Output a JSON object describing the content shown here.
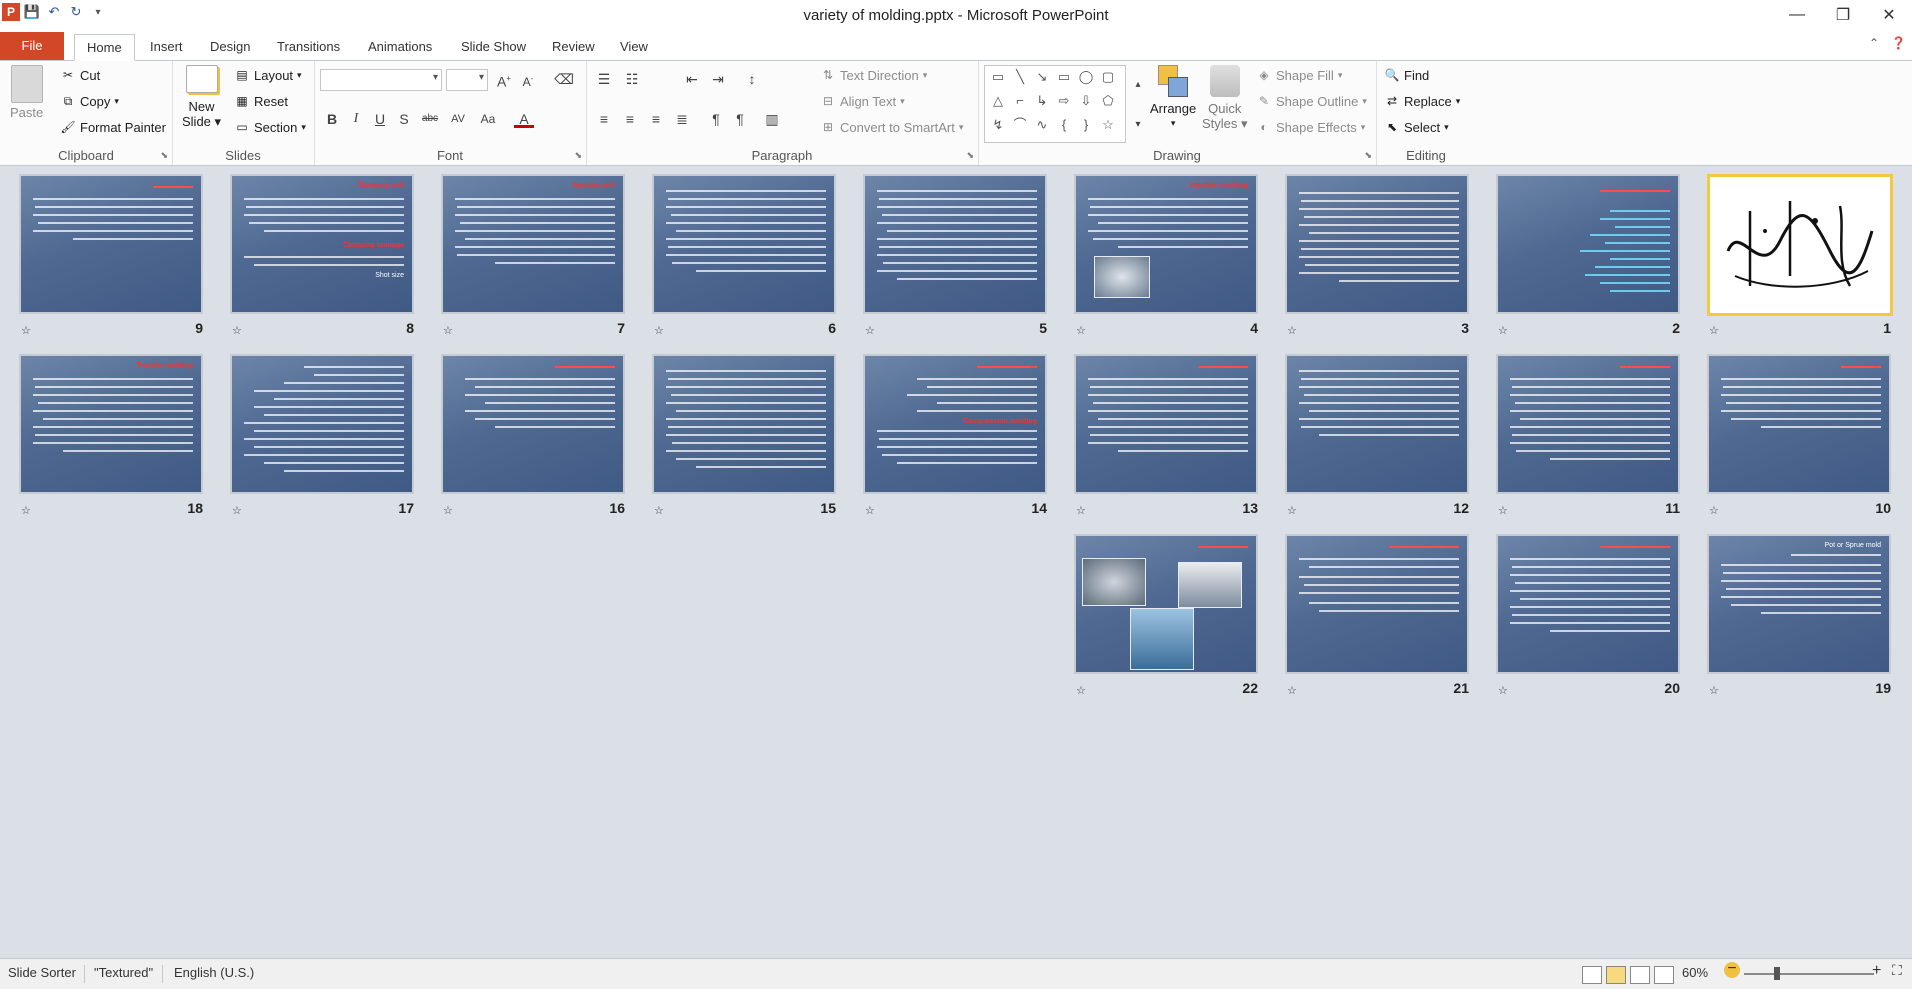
{
  "window": {
    "title": "variety of molding.pptx  -  Microsoft PowerPoint",
    "minimize": "—",
    "restore": "❐",
    "close": "✕"
  },
  "qat": {
    "app_letter": "P",
    "save_icon": "save-icon",
    "undo_icon": "undo-icon",
    "redo_icon": "redo-icon"
  },
  "tabs": [
    "File",
    "Home",
    "Insert",
    "Design",
    "Transitions",
    "Animations",
    "Slide Show",
    "Review",
    "View"
  ],
  "ribbon": {
    "clipboard": {
      "label": "Clipboard",
      "paste": "Paste",
      "cut": "Cut",
      "copy": "Copy",
      "format_painter": "Format Painter"
    },
    "slides": {
      "label": "Slides",
      "new_slide_1": "New",
      "new_slide_2": "Slide",
      "layout": "Layout",
      "reset": "Reset",
      "section": "Section"
    },
    "font": {
      "label": "Font",
      "font_name": "",
      "font_size": ""
    },
    "paragraph": {
      "label": "Paragraph",
      "text_direction": "Text Direction",
      "align_text": "Align Text",
      "convert_smartart": "Convert to SmartArt"
    },
    "drawing": {
      "label": "Drawing",
      "arrange": "Arrange",
      "quick_styles_1": "Quick",
      "quick_styles_2": "Styles",
      "shape_fill": "Shape Fill",
      "shape_outline": "Shape Outline",
      "shape_effects": "Shape Effects"
    },
    "editing": {
      "label": "Editing",
      "find": "Find",
      "replace": "Replace",
      "select": "Select"
    }
  },
  "slides": [
    {
      "number": "1"
    },
    {
      "number": "2"
    },
    {
      "number": "3"
    },
    {
      "number": "4"
    },
    {
      "number": "5"
    },
    {
      "number": "6"
    },
    {
      "number": "7"
    },
    {
      "number": "8"
    },
    {
      "number": "9"
    },
    {
      "number": "10"
    },
    {
      "number": "11"
    },
    {
      "number": "12"
    },
    {
      "number": "13"
    },
    {
      "number": "14"
    },
    {
      "number": "15"
    },
    {
      "number": "16"
    },
    {
      "number": "17"
    },
    {
      "number": "18"
    },
    {
      "number": "19"
    },
    {
      "number": "20"
    },
    {
      "number": "21"
    },
    {
      "number": "22"
    }
  ],
  "slide_text": {
    "s4_title": "Injection molding",
    "s7_title": "Injection unit",
    "s8_title": "Clamping unit",
    "s8_sub1": "Clamping tonnage",
    "s8_sub2": "Shot size",
    "s14_title": "Compression molding",
    "s18_title": "Transfer molding",
    "s19_title": "Pot or Sprue mold"
  },
  "status": {
    "view": "Slide Sorter",
    "theme": "\"Textured\"",
    "language": "English (U.S.)",
    "zoom": "60%"
  }
}
